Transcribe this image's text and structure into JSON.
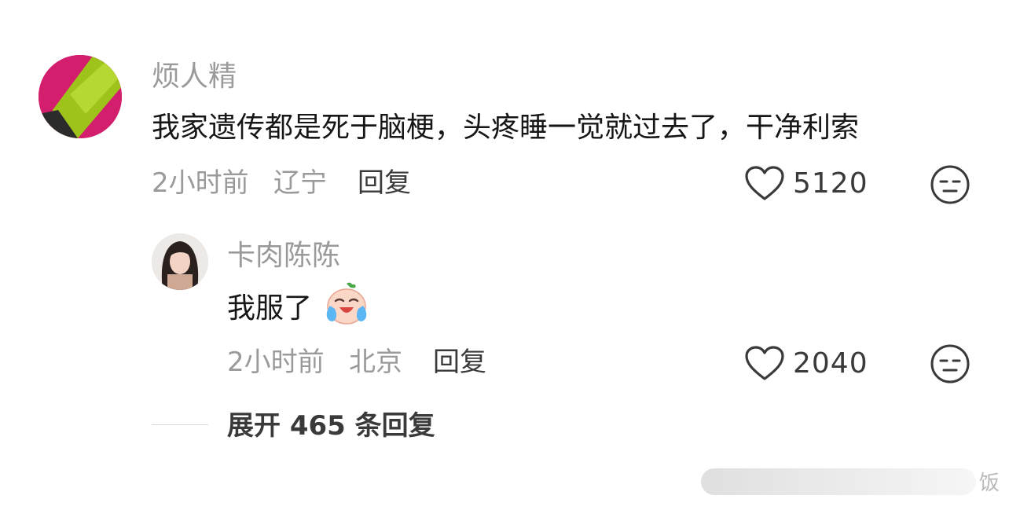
{
  "comment": {
    "username": "烦人精",
    "text": "我家遗传都是死于脑梗，头疼睡一觉就过去了，干净利索",
    "time": "2小时前",
    "location": "辽宁",
    "reply_label": "回复",
    "likes": "5120",
    "avatar_icon": "green-object-avatar"
  },
  "reply": {
    "username": "卡肉陈陈",
    "text": "我服了",
    "emoji_icon": "crying-laughing-emoji",
    "time": "2小时前",
    "location": "北京",
    "reply_label": "回复",
    "likes": "2040",
    "avatar_icon": "girl-portrait-avatar"
  },
  "expand": {
    "label": "展开 465 条回复"
  },
  "watermark": {
    "text": "饭"
  },
  "colors": {
    "username": "#9a9a9a",
    "text": "#161616",
    "accent": "#3a3a3a"
  }
}
